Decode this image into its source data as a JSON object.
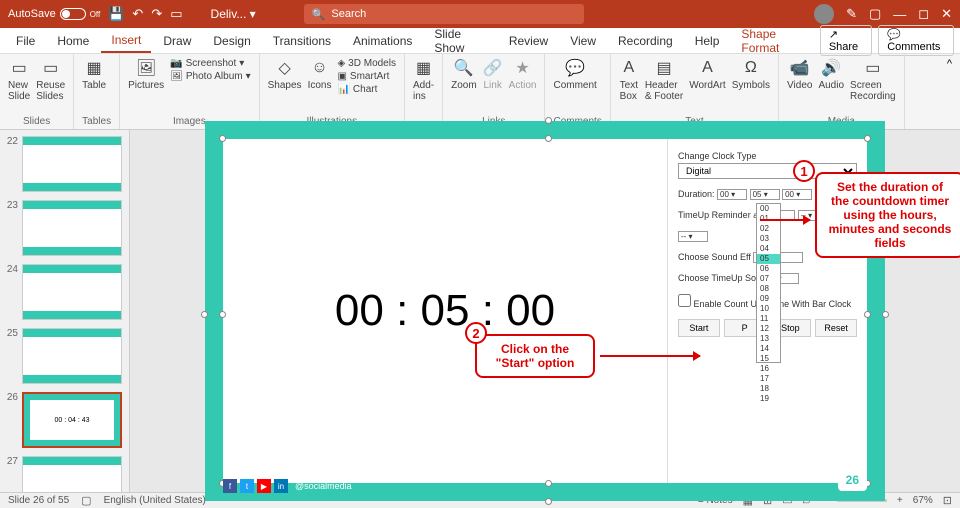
{
  "titlebar": {
    "autosave": "AutoSave",
    "off": "Off",
    "doctitle": "Deliv...",
    "search_placeholder": "Search"
  },
  "menu": {
    "tabs": [
      "File",
      "Home",
      "Insert",
      "Draw",
      "Design",
      "Transitions",
      "Animations",
      "Slide Show",
      "Review",
      "View",
      "Recording",
      "Help",
      "Shape Format"
    ],
    "active": 2,
    "share": "Share",
    "comments": "Comments"
  },
  "ribbon": {
    "groups": [
      {
        "label": "Slides",
        "items": [
          {
            "l": "New\nSlide"
          },
          {
            "l": "Reuse\nSlides"
          }
        ]
      },
      {
        "label": "Tables",
        "items": [
          {
            "l": "Table"
          }
        ]
      },
      {
        "label": "Images",
        "big": {
          "l": "Pictures"
        },
        "small": [
          "Screenshot",
          "Photo Album"
        ]
      },
      {
        "label": "Illustrations",
        "items": [
          {
            "l": "Shapes"
          },
          {
            "l": "Icons"
          }
        ],
        "small": [
          "3D Models",
          "SmartArt",
          "Chart"
        ]
      },
      {
        "label": "",
        "items": [
          {
            "l": "Add-\nins"
          }
        ]
      },
      {
        "label": "Links",
        "items": [
          {
            "l": "Zoom"
          },
          {
            "l": "Link"
          },
          {
            "l": "Action"
          }
        ]
      },
      {
        "label": "Comments",
        "items": [
          {
            "l": "Comment"
          }
        ]
      },
      {
        "label": "Text",
        "items": [
          {
            "l": "Text\nBox"
          },
          {
            "l": "Header\n& Footer"
          },
          {
            "l": "WordArt"
          }
        ],
        "sym": "Symbols"
      },
      {
        "label": "Media",
        "items": [
          {
            "l": "Video"
          },
          {
            "l": "Audio"
          },
          {
            "l": "Screen\nRecording"
          }
        ]
      }
    ]
  },
  "thumbs": [
    {
      "num": "22"
    },
    {
      "num": "23"
    },
    {
      "num": "24"
    },
    {
      "num": "25"
    },
    {
      "num": "26",
      "active": true,
      "text": "00 : 04 : 43"
    },
    {
      "num": "27"
    }
  ],
  "slide": {
    "countdown": "00 : 05 : 00",
    "slidenum": "26",
    "social_handle": "@socialmedia",
    "settings": {
      "clock_type_lbl": "Change Clock Type",
      "clock_type": "Digital",
      "duration_lbl": "Duration:",
      "h": "00",
      "m": "05",
      "s": "00",
      "timeup_lbl": "TimeUp Reminder",
      "sound_lbl": "Choose Sound Eff",
      "timeupsound_lbl": "Choose TimeUp So",
      "alarm": "arm",
      "countup_lbl": "Enable Count U",
      "barclock_lbl": "mbine With Bar Clock",
      "btns": [
        "Start",
        "P",
        "Stop",
        "Reset"
      ],
      "dropdown": [
        "00",
        "01",
        "02",
        "03",
        "04",
        "05",
        "06",
        "07",
        "08",
        "09",
        "10",
        "11",
        "12",
        "13",
        "14",
        "15",
        "16",
        "17",
        "18",
        "19"
      ]
    }
  },
  "callouts": {
    "c1": {
      "num": "1",
      "text": "Set the duration of the countdown timer using the hours, minutes and seconds fields"
    },
    "c2": {
      "num": "2",
      "text": "Click on the \"Start\" option"
    }
  },
  "status": {
    "slide": "Slide 26 of 55",
    "lang": "English (United States)",
    "notes": "Notes",
    "zoom": "67%"
  }
}
